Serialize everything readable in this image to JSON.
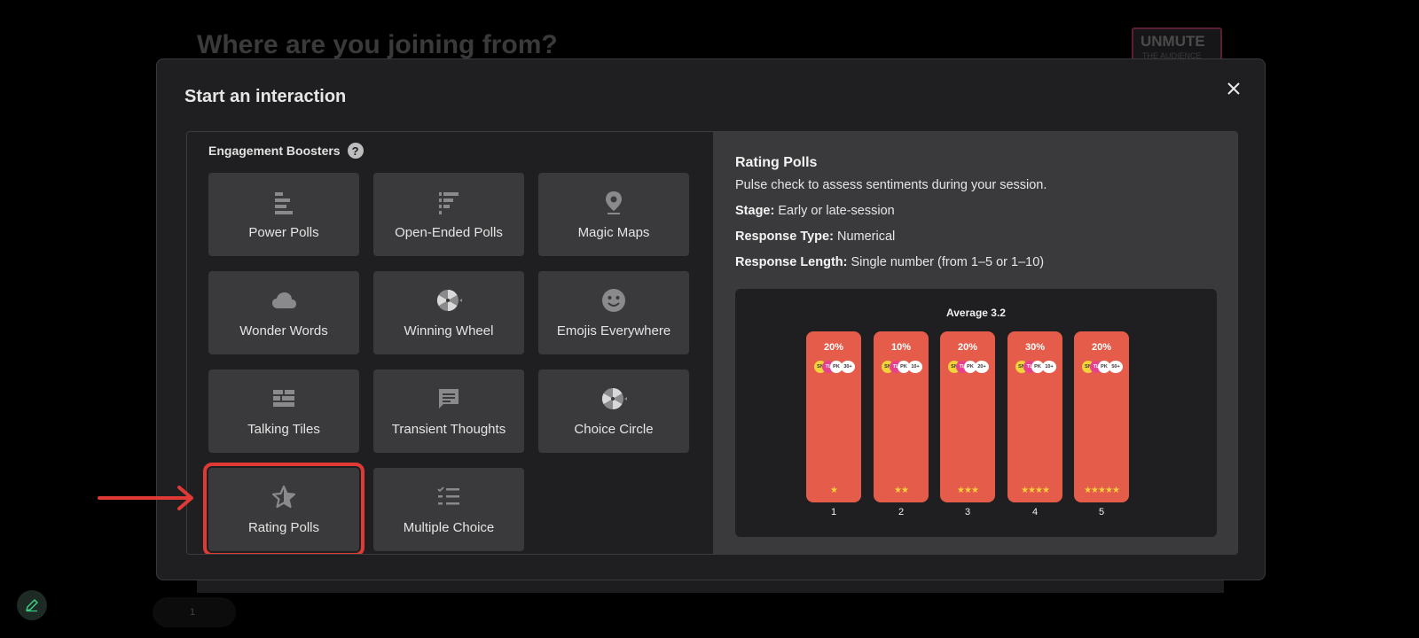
{
  "background": {
    "title": "Where are you joining from?",
    "logo_line1": "UNMUTE",
    "logo_line2": "THE AUDIENCE",
    "pager": "1"
  },
  "modal": {
    "title": "Start an interaction",
    "section": "Engagement Boosters",
    "help_glyph": "?",
    "close_glyph": "×",
    "tiles": [
      {
        "label": "Power Polls",
        "icon": "bar-chart-icon"
      },
      {
        "label": "Open-Ended Polls",
        "icon": "text-lines-icon"
      },
      {
        "label": "Magic Maps",
        "icon": "map-pin-icon"
      },
      {
        "label": "Wonder Words",
        "icon": "cloud-icon"
      },
      {
        "label": "Winning Wheel",
        "icon": "wheel-icon"
      },
      {
        "label": "Emojis Everywhere",
        "icon": "smiley-icon"
      },
      {
        "label": "Talking Tiles",
        "icon": "tiles-icon"
      },
      {
        "label": "Transient Thoughts",
        "icon": "chat-bubble-icon"
      },
      {
        "label": "Choice Circle",
        "icon": "wheel-icon"
      },
      {
        "label": "Rating Polls",
        "icon": "star-icon",
        "selected": true
      },
      {
        "label": "Multiple Choice",
        "icon": "checklist-icon"
      }
    ]
  },
  "details": {
    "title": "Rating Polls",
    "description": "Pulse check to assess sentiments during your session.",
    "stage_label": "Stage:",
    "stage_value": "Early or late-session",
    "type_label": "Response Type:",
    "type_value": "Numerical",
    "length_label": "Response Length:",
    "length_value": "Single number (from 1–5 or 1–10)",
    "preview": {
      "average": "Average 3.2",
      "avatar_initials": [
        "SN",
        "TL",
        "PK"
      ],
      "bars": [
        {
          "pct": "20%",
          "count": "30+",
          "stars": "★",
          "label": "1"
        },
        {
          "pct": "10%",
          "count": "10+",
          "stars": "★★",
          "label": "2"
        },
        {
          "pct": "20%",
          "count": "20+",
          "stars": "★★★",
          "label": "3"
        },
        {
          "pct": "30%",
          "count": "10+",
          "stars": "★★★★",
          "label": "4"
        },
        {
          "pct": "20%",
          "count": "50+",
          "stars": "★★★★★",
          "label": "5"
        }
      ]
    }
  },
  "colors": {
    "bar": "#e65c4a",
    "highlight": "#e03a37",
    "tile": "#3a3a3c",
    "modal": "#1f1f21"
  }
}
